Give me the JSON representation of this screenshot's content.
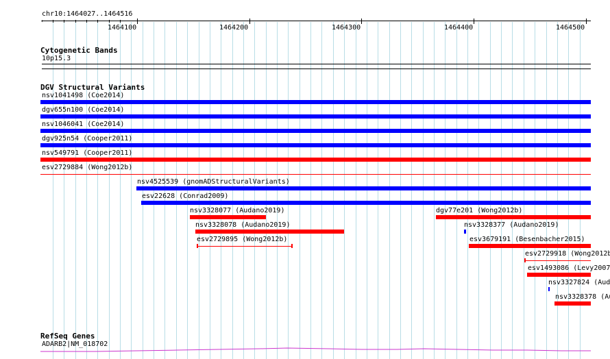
{
  "ruler": {
    "position": "chr10:1464027..1464516",
    "ticks": [
      "1464100",
      "1464200",
      "1464300",
      "1464400",
      "1464500"
    ]
  },
  "cytoband": {
    "title": "Cytogenetic Bands",
    "band": "10p15.3"
  },
  "dgv": {
    "title": "DGV Structural Variants",
    "colors": {
      "gain_loss": "#0000ff",
      "loss": "#ff0000"
    },
    "variants": [
      {
        "label": "nsv1041498 (Coe2014)",
        "color": "#0000ff"
      },
      {
        "label": "dgv655n100 (Coe2014)",
        "color": "#0000ff"
      },
      {
        "label": "nsv1046041 (Coe2014)",
        "color": "#0000ff"
      },
      {
        "label": "dgv925n54 (Cooper2011)",
        "color": "#0000ff"
      },
      {
        "label": "nsv549791 (Cooper2011)",
        "color": "#ff0000"
      },
      {
        "label": "esv2729884 (Wong2012b)",
        "color": "#ff0000"
      },
      {
        "label": "nsv4525539 (gnomADStructuralVariants)",
        "color": "#0000ff"
      },
      {
        "label": "esv22628 (Conrad2009)",
        "color": "#0000ff"
      },
      {
        "label": "nsv3328077 (Audano2019)",
        "color": "#ff0000"
      },
      {
        "label": "dgv77e201 (Wong2012b)",
        "color": "#ff0000"
      },
      {
        "label": "nsv3328078 (Audano2019)",
        "color": "#ff0000"
      },
      {
        "label": "nsv3328377 (Audano2019)",
        "color": "#0000ff"
      },
      {
        "label": "esv2729895 (Wong2012b)",
        "color": "#ff0000"
      },
      {
        "label": "esv3679191 (Besenbacher2015)",
        "color": "#ff0000"
      },
      {
        "label": "esv2729918 (Wong2012b",
        "color": "#ff0000"
      },
      {
        "label": "esv1493086 (Levy2007",
        "color": "#ff0000"
      },
      {
        "label": "nsv3327824 (Aud",
        "color": "#0000ff"
      },
      {
        "label": "nsv3328378 (Au",
        "color": "#ff0000"
      }
    ]
  },
  "refseq": {
    "title": "RefSeq Genes",
    "gene": "ADARB2|NM_018702",
    "color": "#cc33cc"
  }
}
